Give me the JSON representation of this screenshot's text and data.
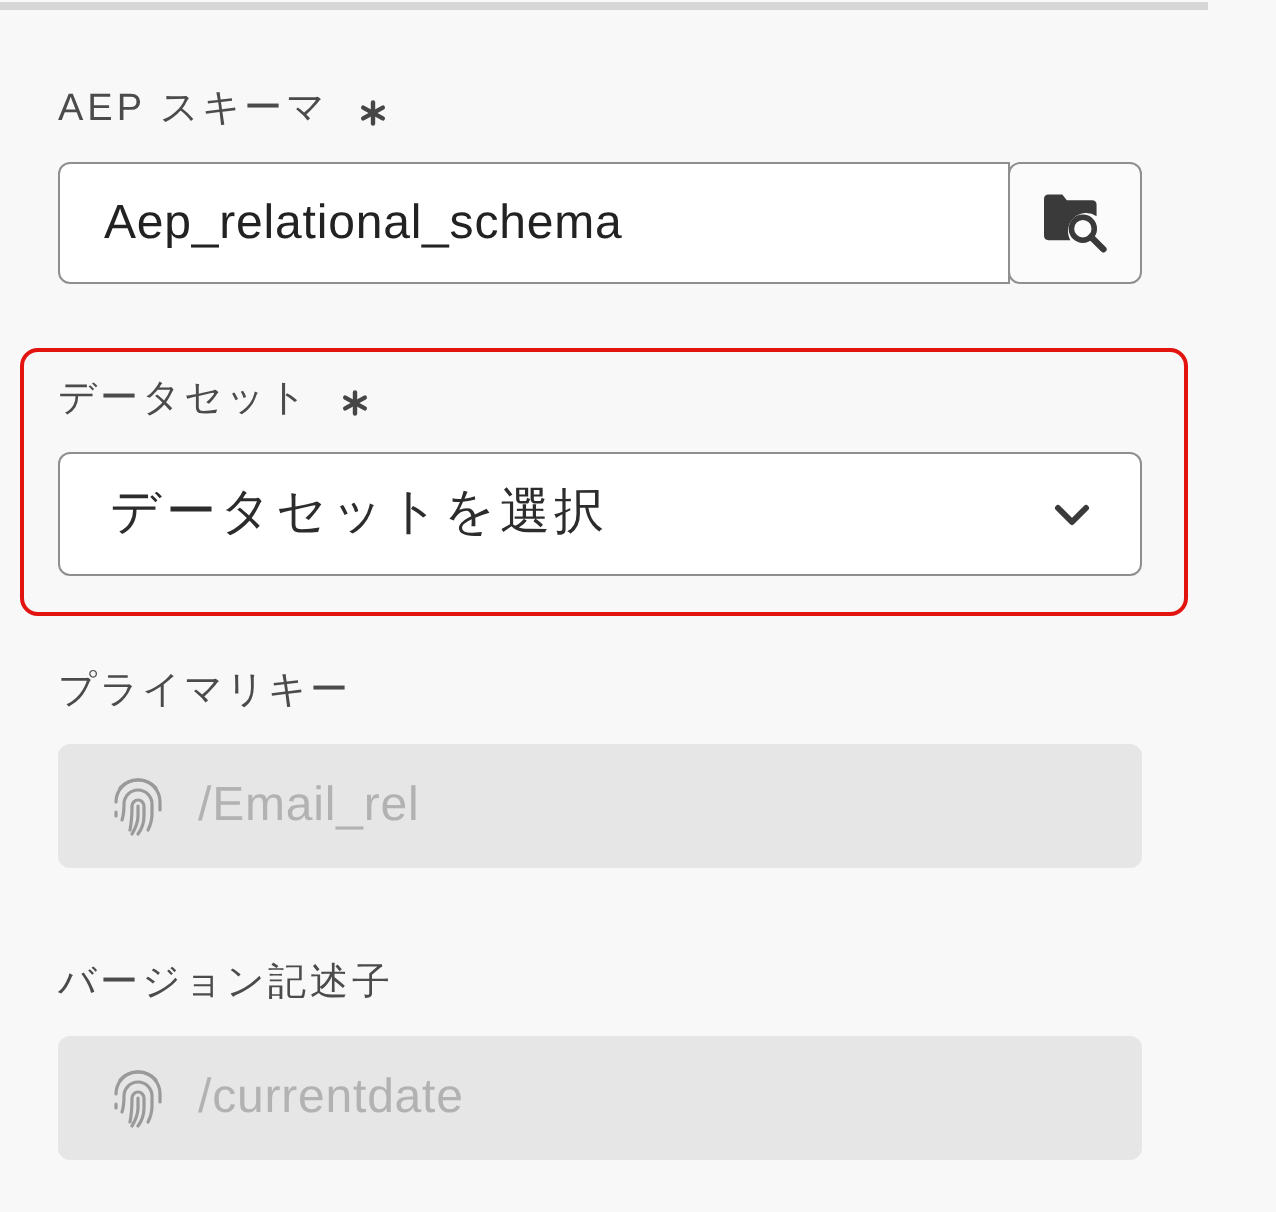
{
  "fields": [
    {
      "kind": "browse",
      "label": "AEP スキーマ",
      "required": true,
      "highlighted": false,
      "disabled": false,
      "value": "Aep_relational_schema"
    },
    {
      "kind": "dropdown",
      "label": "データセット",
      "required": true,
      "highlighted": true,
      "disabled": false,
      "placeholder": "データセットを選択"
    },
    {
      "kind": "readonly",
      "label": "プライマリキー",
      "required": false,
      "highlighted": false,
      "disabled": true,
      "value": "/Email_rel"
    },
    {
      "kind": "readonly",
      "label": "バージョン記述子",
      "required": false,
      "highlighted": false,
      "disabled": true,
      "value": "/currentdate"
    }
  ]
}
